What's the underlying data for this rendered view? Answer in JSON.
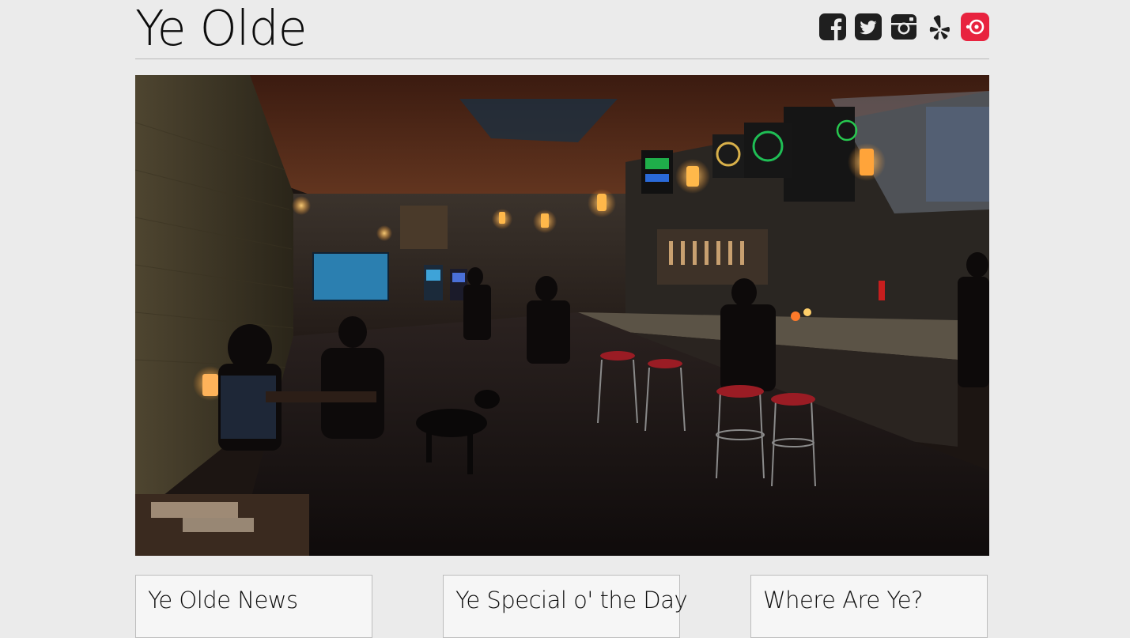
{
  "site": {
    "title": "Ye Olde"
  },
  "social": [
    {
      "name": "facebook",
      "icon": "facebook-icon",
      "color": "#1f1f1f"
    },
    {
      "name": "twitter",
      "icon": "twitter-icon",
      "color": "#1f1f1f"
    },
    {
      "name": "instagram",
      "icon": "instagram-icon",
      "color": "#1f1f1f"
    },
    {
      "name": "yelp",
      "icon": "yelp-icon",
      "color": "#1f1f1f"
    },
    {
      "name": "foursquare",
      "icon": "foursquare-icon",
      "color": "#e8233f"
    }
  ],
  "hero": {
    "alt": "bar-interior-photo"
  },
  "cards": [
    {
      "title": "Ye Olde News"
    },
    {
      "title": "Ye Special o' the Day"
    },
    {
      "title": "Where Are Ye?"
    }
  ],
  "colors": {
    "background": "#ebebeb",
    "card_bg": "#f6f6f6",
    "icon_dark": "#1f1f1f",
    "accent": "#e8233f"
  }
}
